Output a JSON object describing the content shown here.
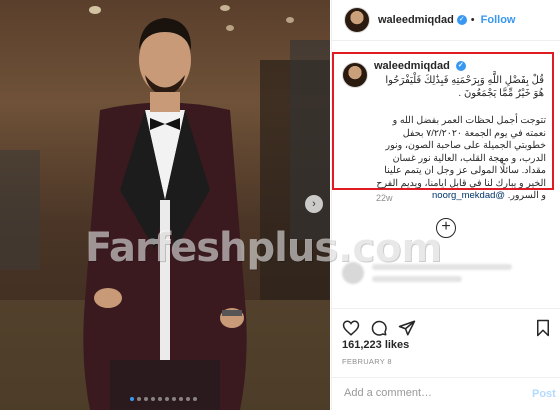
{
  "post": {
    "username": "waleedmiqdad",
    "follow_label": "Follow",
    "separator": "•",
    "verified_icon": "✓",
    "caption": {
      "verse": "قُلْ بِفَضْلِ اللَّهِ وَبِرَحْمَتِهِ فَبِذَٰلِكَ فَلْيَفْرَحُوا هُوَ خَيْرٌ مِّمَّا يَجْمَعُونَ .",
      "body": "تتوجت أجمل لحظات العمر بفضل الله و نعمته في يوم الجمعة ٧/٢/٢٠٢٠ بحفل خطوبتي الجميلة على صاحبة الصون، ونور الدرب، و مهجة القلب، العالية نور غسان مقداد. سائلًا المولى عز وجل ان يتمم علينا الخير و يبارك لنا في قابل ايامنا، ويديم الفرح و السرور.",
      "mention": "@noorg_mekdad"
    },
    "age": "22w",
    "likes": "161,223 likes",
    "date": "FEBRUARY 8",
    "comment_placeholder": "Add a comment…",
    "post_label": "Post",
    "watermark": "Farfeshplus.com",
    "photo_dots": 10,
    "active_dot": 1,
    "accent": "#3897f0",
    "highlight": "#e01b24"
  }
}
